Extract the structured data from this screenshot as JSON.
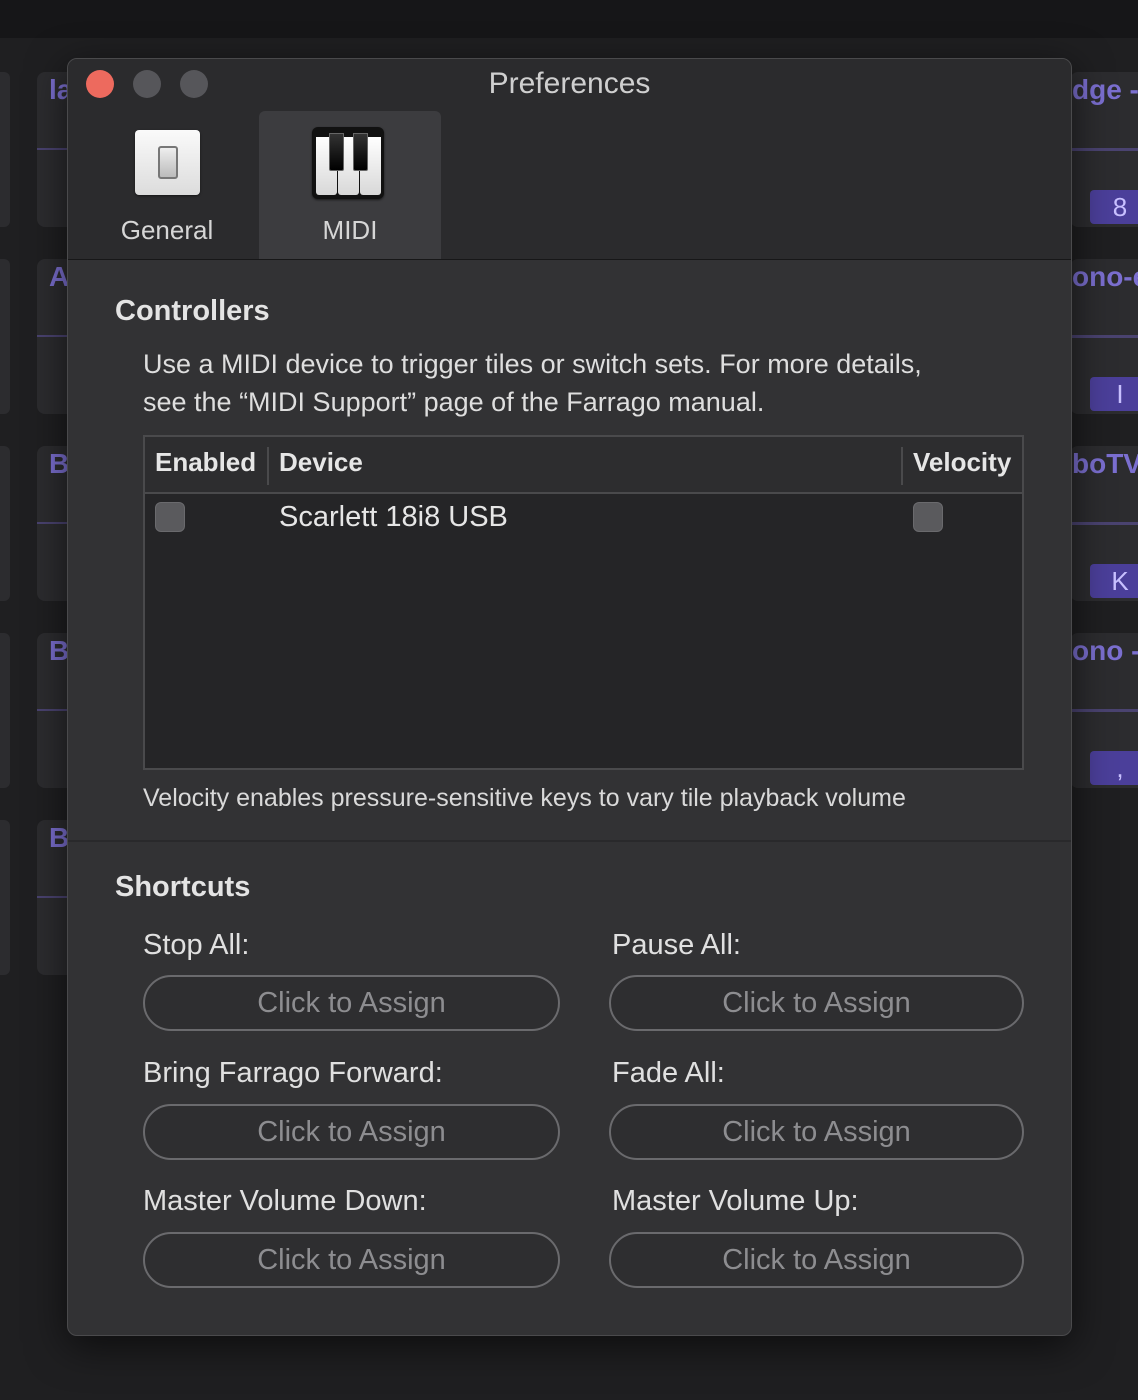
{
  "background": {
    "left_tiles": [
      "la",
      "A",
      "B",
      "B",
      "B"
    ],
    "right_tiles": [
      {
        "title": "dge -",
        "key": "8"
      },
      {
        "title": "ono-e",
        "key": "I"
      },
      {
        "title": "boTV",
        "key": "K"
      },
      {
        "title": "ono -",
        "key": ","
      }
    ]
  },
  "window": {
    "title": "Preferences",
    "tabs": [
      {
        "label": "General",
        "icon": "light-switch-icon",
        "active": false
      },
      {
        "label": "MIDI",
        "icon": "piano-keys-icon",
        "active": true
      }
    ]
  },
  "controllers": {
    "title": "Controllers",
    "description_line1": "Use a MIDI device to trigger tiles or switch sets. For more details,",
    "description_line2": "see the “MIDI Support” page of the Farrago manual.",
    "columns": {
      "enabled": "Enabled",
      "device": "Device",
      "velocity": "Velocity"
    },
    "rows": [
      {
        "enabled": false,
        "device": "Scarlett 18i8 USB",
        "velocity": false
      }
    ],
    "note": "Velocity enables pressure-sensitive keys to vary tile playback volume"
  },
  "shortcuts": {
    "title": "Shortcuts",
    "button_label": "Click to Assign",
    "items": [
      {
        "label": "Stop All:",
        "button": "Click to Assign"
      },
      {
        "label": "Pause All:",
        "button": "Click to Assign"
      },
      {
        "label": "Bring Farrago Forward:",
        "button": "Click to Assign"
      },
      {
        "label": "Fade All:",
        "button": "Click to Assign"
      },
      {
        "label": "Master Volume Down:",
        "button": "Click to Assign"
      },
      {
        "label": "Master Volume Up:",
        "button": "Click to Assign"
      }
    ]
  }
}
